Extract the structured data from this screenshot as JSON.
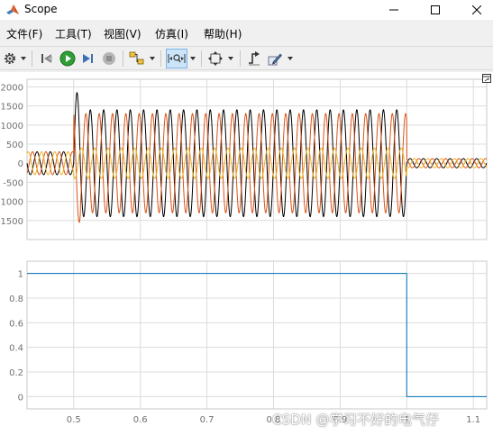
{
  "window": {
    "title": "Scope"
  },
  "menu": [
    {
      "label": "文件(F)"
    },
    {
      "label": "工具(T)"
    },
    {
      "label": "视图(V)"
    },
    {
      "label": "仿真(I)"
    },
    {
      "label": "帮助(H)"
    }
  ],
  "toolbar": {
    "icons": [
      "settings-icon",
      "step-back-icon",
      "run-icon",
      "step-forward-icon",
      "stop-icon",
      "highlight-block-icon",
      "zoom-icon",
      "fit-axes-icon",
      "triggers-icon",
      "style-icon"
    ]
  },
  "colors": {
    "grid": "#dcdcdc",
    "axis": "#c8c8c8",
    "tick_text": "#707070",
    "series_black": "#000000",
    "series_orange": "#d95319",
    "series_yellow": "#edb120",
    "series_blue": "#0072bd"
  },
  "chart_data": [
    {
      "type": "line",
      "ylim": [
        -2000,
        2200
      ],
      "yticks": [
        "2000",
        "1500",
        "1000",
        "500",
        "0",
        "-500",
        "-1000",
        "-1500"
      ],
      "xlim": [
        0.43,
        1.12
      ],
      "series": [
        {
          "color": "#000000",
          "frequency_hz": 50,
          "phase": 0,
          "segments": [
            {
              "x": [
                0.43,
                0.5
              ],
              "amplitude": 300
            },
            {
              "x": [
                0.5,
                0.51
              ],
              "amplitude": 1850
            },
            {
              "x": [
                0.51,
                1.0
              ],
              "amplitude": 1400
            },
            {
              "x": [
                1.0,
                1.12
              ],
              "amplitude": 120
            }
          ]
        },
        {
          "color": "#d95319",
          "frequency_hz": 50,
          "phase": 2.094,
          "segments": [
            {
              "x": [
                0.43,
                0.5
              ],
              "amplitude": 300
            },
            {
              "x": [
                0.5,
                0.51
              ],
              "amplitude": 1550
            },
            {
              "x": [
                0.51,
                1.0
              ],
              "amplitude": 1300
            },
            {
              "x": [
                1.0,
                1.12
              ],
              "amplitude": 120
            }
          ]
        },
        {
          "color": "#edb120",
          "frequency_hz": 50,
          "phase": 4.189,
          "segments": [
            {
              "x": [
                0.43,
                0.5
              ],
              "amplitude": 300
            },
            {
              "x": [
                0.5,
                1.0
              ],
              "amplitude": 400
            },
            {
              "x": [
                1.0,
                1.12
              ],
              "amplitude": 120
            }
          ]
        }
      ]
    },
    {
      "type": "line",
      "ylim": [
        -0.1,
        1.1
      ],
      "yticks": [
        "1",
        "0.8",
        "0.6",
        "0.4",
        "0.2",
        "0"
      ],
      "xlim": [
        0.43,
        1.12
      ],
      "xticks": [
        "0.5",
        "0.6",
        "0.7",
        "0.8",
        "0.9",
        "1",
        "1.1"
      ],
      "series": [
        {
          "color": "#0072bd",
          "x": [
            0.43,
            1.0,
            1.0,
            1.12
          ],
          "y": [
            1,
            1,
            0,
            0
          ]
        }
      ]
    }
  ],
  "watermark": "CSDN @学习不好的电气仔"
}
